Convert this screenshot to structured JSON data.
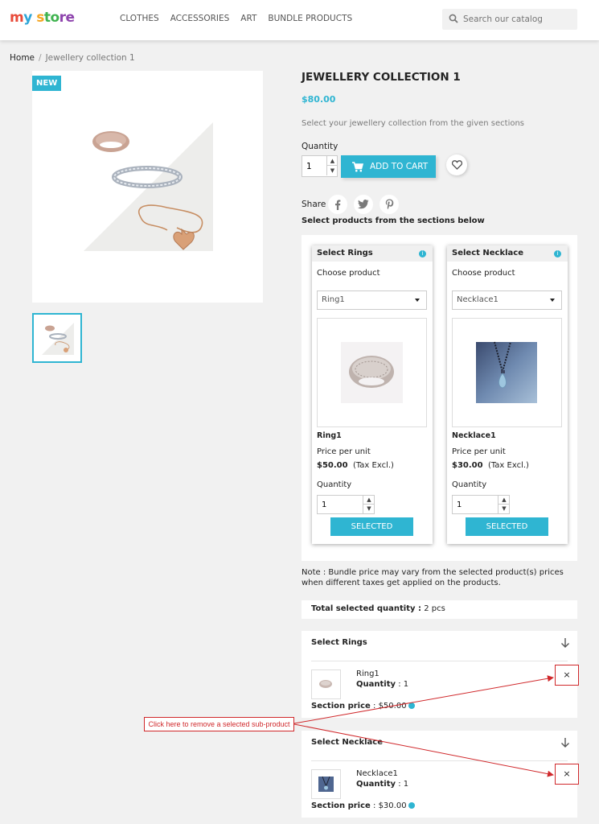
{
  "header": {
    "logo": [
      "m",
      "y",
      " s",
      "to",
      "re"
    ],
    "nav": [
      "CLOTHES",
      "ACCESSORIES",
      "ART",
      "BUNDLE PRODUCTS"
    ],
    "search_placeholder": "Search our catalog"
  },
  "breadcrumb": {
    "home": "Home",
    "sep": "/",
    "current": "Jewellery collection 1"
  },
  "product": {
    "badge": "NEW",
    "title": "JEWELLERY COLLECTION 1",
    "price": "$80.00",
    "description": "Select your jewellery collection from the given sections",
    "quantity_label": "Quantity",
    "quantity": "1",
    "add_to_cart": "ADD TO CART",
    "share_label": "Share",
    "select_products_title": "Select products from the sections below"
  },
  "sections": [
    {
      "title": "Select Rings",
      "choose": "Choose product",
      "selected_option": "Ring1",
      "product_name": "Ring1",
      "price_per_unit": "Price per unit",
      "price": "$50.00",
      "tax": "(Tax Excl.)",
      "quantity_label": "Quantity",
      "quantity": "1",
      "button": "SELECTED"
    },
    {
      "title": "Select Necklace",
      "choose": "Choose product",
      "selected_option": "Necklace1",
      "product_name": "Necklace1",
      "price_per_unit": "Price per unit",
      "price": "$30.00",
      "tax": "(Tax Excl.)",
      "quantity_label": "Quantity",
      "quantity": "1",
      "button": "SELECTED"
    }
  ],
  "note": "Note : Bundle price may vary from the selected product(s) prices when different taxes get applied on the products.",
  "total": {
    "label": "Total selected quantity :",
    "value": "2 pcs"
  },
  "summary": [
    {
      "title": "Select Rings",
      "item_name": "Ring1",
      "quantity_label": "Quantity",
      "quantity_value": ": 1",
      "section_price_label": "Section price",
      "section_price": ": $50.00",
      "remove": "×"
    },
    {
      "title": "Select Necklace",
      "item_name": "Necklace1",
      "quantity_label": "Quantity",
      "quantity_value": ": 1",
      "section_price_label": "Section price",
      "section_price": ": $30.00",
      "remove": "×"
    }
  ],
  "annotation": "Click here to remove a selected sub-product",
  "colors": {
    "accent": "#2fb5d2",
    "annotation": "#d0282b"
  }
}
